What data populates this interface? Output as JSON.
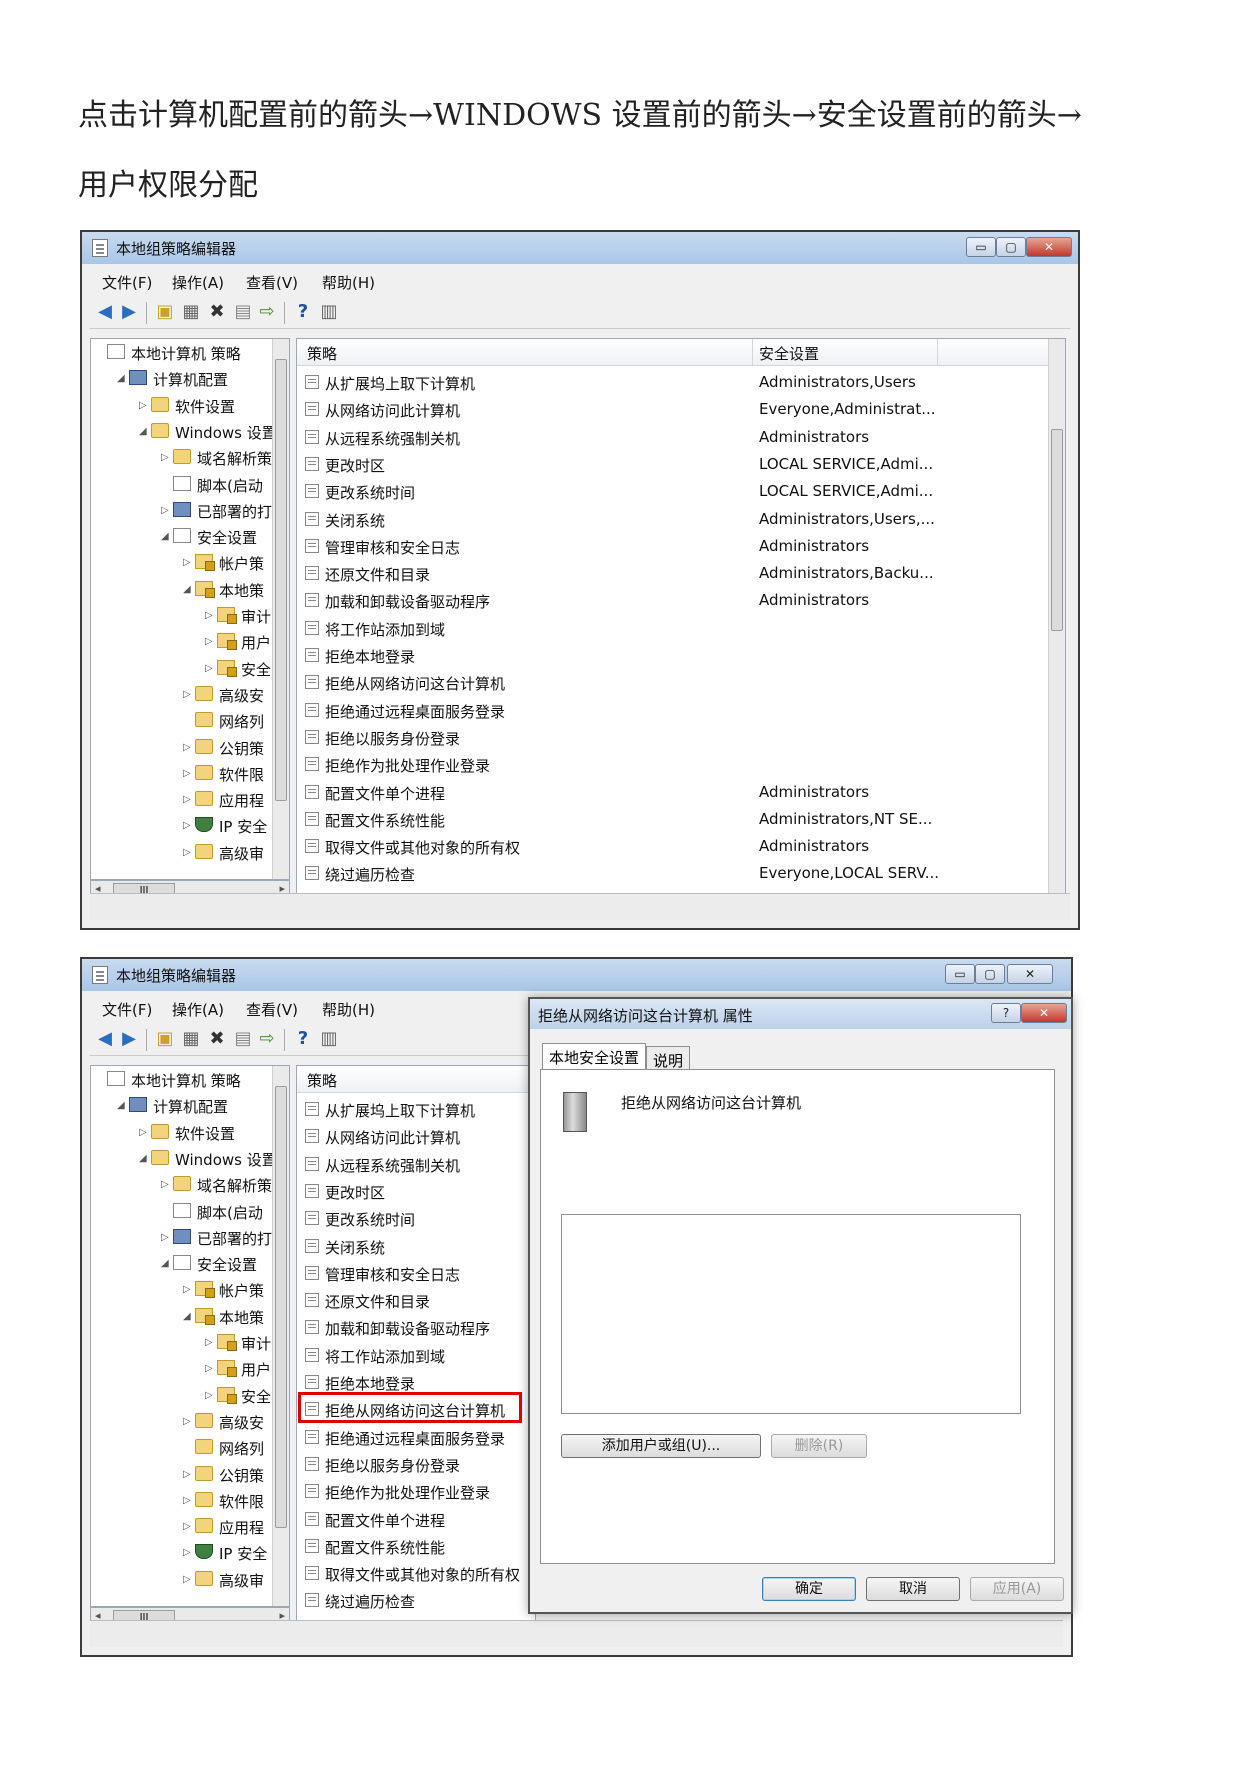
{
  "instruction": {
    "line1": "点击计算机配置前的箭头→WINDOWS 设置前的箭头→安全设置前的箭头→",
    "line2": "用户权限分配"
  },
  "window": {
    "title": "本地组策略编辑器",
    "menu": [
      "文件(F)",
      "操作(A)",
      "查看(V)",
      "帮助(H)"
    ],
    "controls": {
      "minimize": "▭",
      "maximize": "▢",
      "close": "✕"
    }
  },
  "toolbar_icons": [
    "back-arrow-icon",
    "forward-arrow-icon",
    "up-folder-icon",
    "show-hide-tree-icon",
    "delete-icon",
    "properties-icon",
    "export-icon",
    "help-icon",
    "view-icon"
  ],
  "tree": [
    {
      "label": "本地计算机 策略",
      "level": 0,
      "icon": "doc",
      "arrow": ""
    },
    {
      "label": "计算机配置",
      "level": 1,
      "icon": "pc",
      "arrow": "◢"
    },
    {
      "label": "软件设置",
      "level": 2,
      "icon": "folder",
      "arrow": "▷"
    },
    {
      "label": "Windows 设置",
      "level": 2,
      "icon": "folder",
      "arrow": "◢"
    },
    {
      "label": "域名解析策略",
      "level": 3,
      "icon": "folder",
      "arrow": "▷"
    },
    {
      "label": "脚本(启动",
      "level": 3,
      "icon": "doc",
      "arrow": ""
    },
    {
      "label": "已部署的打",
      "level": 3,
      "icon": "pc",
      "arrow": "▷"
    },
    {
      "label": "安全设置",
      "level": 3,
      "icon": "doc",
      "arrow": "◢"
    },
    {
      "label": "帐户策",
      "level": 4,
      "icon": "lockfolder",
      "arrow": "▷"
    },
    {
      "label": "本地策",
      "level": 4,
      "icon": "lockfolder",
      "arrow": "◢"
    },
    {
      "label": "审计",
      "level": 5,
      "icon": "lockfolder",
      "arrow": "▷"
    },
    {
      "label": "用户",
      "level": 5,
      "icon": "lockfolder",
      "arrow": "▷"
    },
    {
      "label": "安全",
      "level": 5,
      "icon": "lockfolder",
      "arrow": "▷"
    },
    {
      "label": "高级安",
      "level": 4,
      "icon": "folder",
      "arrow": "▷"
    },
    {
      "label": "网络列",
      "level": 4,
      "icon": "folder",
      "arrow": ""
    },
    {
      "label": "公钥策",
      "level": 4,
      "icon": "folder",
      "arrow": "▷"
    },
    {
      "label": "软件限",
      "level": 4,
      "icon": "folder",
      "arrow": "▷"
    },
    {
      "label": "应用程",
      "level": 4,
      "icon": "folder",
      "arrow": "▷"
    },
    {
      "label": "IP 安全",
      "level": 4,
      "icon": "shield",
      "arrow": "▷"
    },
    {
      "label": "高级审",
      "level": 4,
      "icon": "folder",
      "arrow": "▷"
    }
  ],
  "hscroll_thumb": "III",
  "columns": {
    "policy": "策略",
    "setting": "安全设置"
  },
  "policies": [
    {
      "name": "从扩展坞上取下计算机",
      "setting": "Administrators,Users"
    },
    {
      "name": "从网络访问此计算机",
      "setting": "Everyone,Administrat..."
    },
    {
      "name": "从远程系统强制关机",
      "setting": "Administrators"
    },
    {
      "name": "更改时区",
      "setting": "LOCAL SERVICE,Admi..."
    },
    {
      "name": "更改系统时间",
      "setting": "LOCAL SERVICE,Admi..."
    },
    {
      "name": "关闭系统",
      "setting": "Administrators,Users,..."
    },
    {
      "name": "管理审核和安全日志",
      "setting": "Administrators"
    },
    {
      "name": "还原文件和目录",
      "setting": "Administrators,Backu..."
    },
    {
      "name": "加载和卸载设备驱动程序",
      "setting": "Administrators"
    },
    {
      "name": "将工作站添加到域",
      "setting": ""
    },
    {
      "name": "拒绝本地登录",
      "setting": ""
    },
    {
      "name": "拒绝从网络访问这台计算机",
      "setting": ""
    },
    {
      "name": "拒绝通过远程桌面服务登录",
      "setting": ""
    },
    {
      "name": "拒绝以服务身份登录",
      "setting": ""
    },
    {
      "name": "拒绝作为批处理作业登录",
      "setting": ""
    },
    {
      "name": "配置文件单个进程",
      "setting": "Administrators"
    },
    {
      "name": "配置文件系统性能",
      "setting": "Administrators,NT SE..."
    },
    {
      "name": "取得文件或其他对象的所有权",
      "setting": "Administrators"
    },
    {
      "name": "绕过遍历检查",
      "setting": "Everyone,LOCAL SERV..."
    }
  ],
  "dialog": {
    "title": "拒绝从网络访问这台计算机 属性",
    "help_button": "?",
    "close_button": "✕",
    "tabs": [
      "本地安全设置",
      "说明"
    ],
    "policy_name": "拒绝从网络访问这台计算机",
    "add_button": "添加用户或组(U)...",
    "remove_button": "删除(R)",
    "ok_button": "确定",
    "cancel_button": "取消",
    "apply_button": "应用(A)"
  },
  "colors": {
    "highlight": "#e00000",
    "titlebar": "#b8cfea"
  }
}
